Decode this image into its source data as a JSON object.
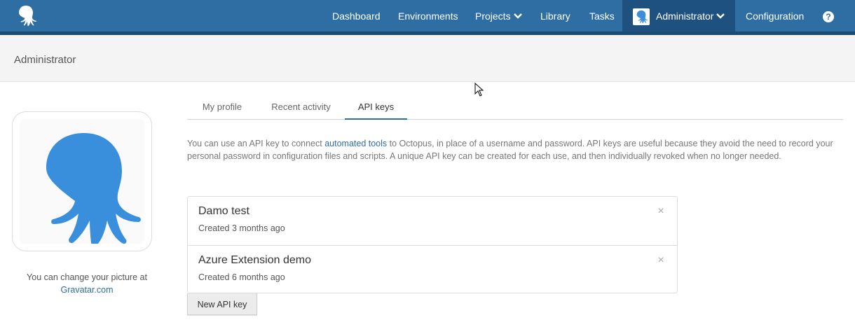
{
  "nav": {
    "items": [
      {
        "label": "Dashboard"
      },
      {
        "label": "Environments"
      },
      {
        "label": "Projects"
      },
      {
        "label": "Library"
      },
      {
        "label": "Tasks"
      },
      {
        "label": "Administrator"
      },
      {
        "label": "Configuration"
      }
    ],
    "help_label": "?"
  },
  "page": {
    "title": "Administrator"
  },
  "profile": {
    "caption_prefix": "You can change your picture at",
    "caption_link": "Gravatar.com"
  },
  "tabs": [
    {
      "label": "My profile",
      "active": false
    },
    {
      "label": "Recent activity",
      "active": false
    },
    {
      "label": "API keys",
      "active": true
    }
  ],
  "description": {
    "before_link": "You can use an API key to connect ",
    "link": "automated tools",
    "after_link": " to Octopus, in place of a username and password. API keys are useful because they avoid the need to record your personal password in configuration files and scripts. A unique API key can be created for each use, and then individually revoked when no longer needed."
  },
  "api_keys": [
    {
      "name": "Damo test",
      "created": "Created 3 months ago",
      "remove": "×"
    },
    {
      "name": "Azure Extension demo",
      "created": "Created 6 months ago",
      "remove": "×"
    }
  ],
  "new_key_button": "New API key",
  "colors": {
    "nav_bg": "#2f6ea2",
    "nav_active_bg": "#1f5180",
    "accent": "#2f6ea2",
    "octopus_blue": "#3a8fdd"
  },
  "icons": {
    "logo": "octopus-logo-icon",
    "avatar": "octopus-avatar-icon",
    "help": "help-circle-icon",
    "chevron": "chevron-down-icon",
    "remove": "close-icon"
  }
}
